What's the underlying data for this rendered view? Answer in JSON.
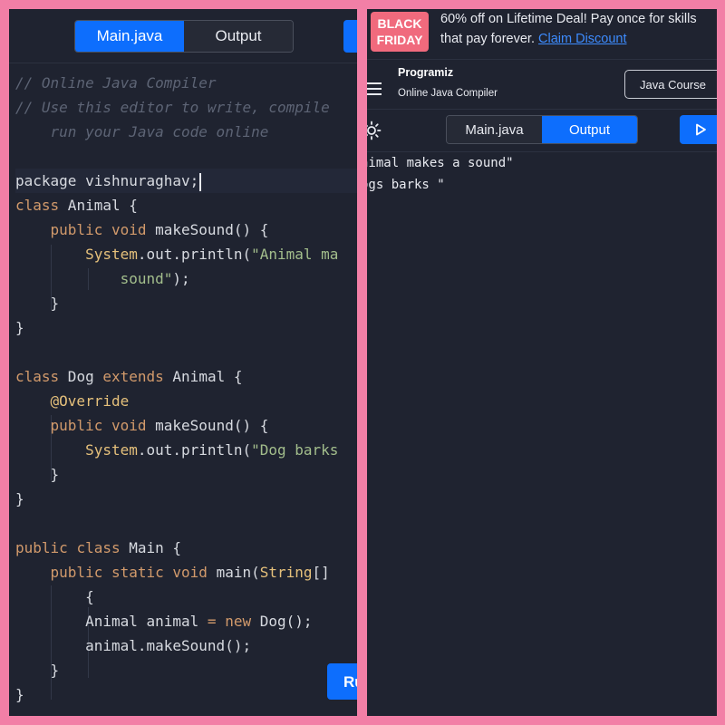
{
  "editor_panel": {
    "tabs": [
      {
        "label": "Main.java",
        "active": true
      },
      {
        "label": "Output",
        "active": false
      }
    ],
    "run_button_label": "Ru",
    "code_lines": [
      [
        {
          "t": "// Online Java Compiler",
          "c": "comment"
        }
      ],
      [
        {
          "t": "// Use this editor to write, compile",
          "c": "comment"
        }
      ],
      [
        {
          "t": "    run your Java code online",
          "c": "comment"
        }
      ],
      [],
      [
        {
          "t": "package vishnuraghav;",
          "c": ""
        }
      ],
      [
        {
          "t": "class",
          "c": "kw"
        },
        {
          "t": " Animal {",
          "c": ""
        }
      ],
      [
        {
          "t": "    ",
          "c": ""
        },
        {
          "t": "public",
          "c": "kw"
        },
        {
          "t": " ",
          "c": ""
        },
        {
          "t": "void",
          "c": "kw"
        },
        {
          "t": " makeSound() {",
          "c": ""
        }
      ],
      [
        {
          "t": "        ",
          "c": ""
        },
        {
          "t": "System",
          "c": "type"
        },
        {
          "t": ".out.println(",
          "c": ""
        },
        {
          "t": "\"Animal ma",
          "c": "str"
        }
      ],
      [
        {
          "t": "            ",
          "c": ""
        },
        {
          "t": "sound\"",
          "c": "str"
        },
        {
          "t": ");",
          "c": ""
        }
      ],
      [
        {
          "t": "    }",
          "c": ""
        }
      ],
      [
        {
          "t": "}",
          "c": ""
        }
      ],
      [],
      [
        {
          "t": "class",
          "c": "kw"
        },
        {
          "t": " Dog ",
          "c": ""
        },
        {
          "t": "extends",
          "c": "kw"
        },
        {
          "t": " Animal {",
          "c": ""
        }
      ],
      [
        {
          "t": "    ",
          "c": ""
        },
        {
          "t": "@Override",
          "c": "anno"
        }
      ],
      [
        {
          "t": "    ",
          "c": ""
        },
        {
          "t": "public",
          "c": "kw"
        },
        {
          "t": " ",
          "c": ""
        },
        {
          "t": "void",
          "c": "kw"
        },
        {
          "t": " makeSound() {",
          "c": ""
        }
      ],
      [
        {
          "t": "        ",
          "c": ""
        },
        {
          "t": "System",
          "c": "type"
        },
        {
          "t": ".out.println(",
          "c": ""
        },
        {
          "t": "\"Dog barks",
          "c": "str"
        }
      ],
      [
        {
          "t": "    }",
          "c": ""
        }
      ],
      [
        {
          "t": "}",
          "c": ""
        }
      ],
      [],
      [
        {
          "t": "public",
          "c": "kw"
        },
        {
          "t": " ",
          "c": ""
        },
        {
          "t": "class",
          "c": "kw"
        },
        {
          "t": " Main {",
          "c": ""
        }
      ],
      [
        {
          "t": "    ",
          "c": ""
        },
        {
          "t": "public",
          "c": "kw"
        },
        {
          "t": " ",
          "c": ""
        },
        {
          "t": "static",
          "c": "kw"
        },
        {
          "t": " ",
          "c": ""
        },
        {
          "t": "void",
          "c": "kw"
        },
        {
          "t": " main(",
          "c": ""
        },
        {
          "t": "String",
          "c": "type"
        },
        {
          "t": "[]",
          "c": ""
        }
      ],
      [
        {
          "t": "        {",
          "c": ""
        }
      ],
      [
        {
          "t": "        Animal animal ",
          "c": ""
        },
        {
          "t": "=",
          "c": "op"
        },
        {
          "t": " ",
          "c": ""
        },
        {
          "t": "new",
          "c": "kw"
        },
        {
          "t": " Dog();",
          "c": ""
        }
      ],
      [
        {
          "t": "        animal.makeSound();",
          "c": ""
        }
      ],
      [
        {
          "t": "    }",
          "c": ""
        }
      ],
      [
        {
          "t": "}",
          "c": ""
        }
      ]
    ]
  },
  "output_panel": {
    "promo": {
      "badge_line1": "BLACK",
      "badge_line2": "FRIDAY",
      "text": "60% off on Lifetime Deal! Pay once for skills that pay forever.",
      "link": "Claim Discount"
    },
    "header": {
      "brand": "Programiz",
      "subtitle": "Online Java Compiler",
      "course_button": "Java Course"
    },
    "tabs": [
      {
        "label": "Main.java",
        "active": false
      },
      {
        "label": "Output",
        "active": true
      }
    ],
    "output_lines": [
      "nimal makes a sound\"",
      "ogs barks \""
    ]
  },
  "colors": {
    "frame": "#f27fa6",
    "background": "#1f2330",
    "accent": "#0d6efd",
    "badge": "#f06a7d"
  }
}
